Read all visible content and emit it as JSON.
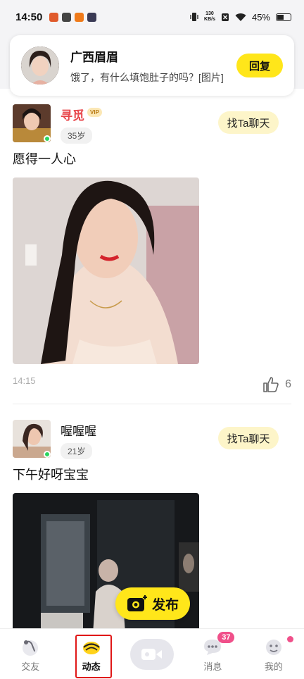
{
  "status_bar": {
    "time": "14:50",
    "net_speed_value": "130",
    "net_speed_unit": "KB/s",
    "battery": "45%"
  },
  "notification": {
    "name": "广西眉眉",
    "message": "饿了，有什么填饱肚子的吗？[图片]",
    "reply_label": "回复"
  },
  "posts": [
    {
      "user_name": "寻觅",
      "vip_label": "VIP",
      "age": "35岁",
      "chat_label": "找Ta聊天",
      "text": "愿得一人心",
      "time": "14:15",
      "likes": "6"
    },
    {
      "user_name": "喔喔喔",
      "age": "21岁",
      "chat_label": "找Ta聊天",
      "text": "下午好呀宝宝"
    }
  ],
  "fab": {
    "label": "发布"
  },
  "bottom_nav": {
    "items": [
      {
        "label": "交友",
        "icon": "friends-icon"
      },
      {
        "label": "动态",
        "icon": "moments-icon"
      },
      {
        "label": "",
        "icon": "video-icon"
      },
      {
        "label": "消息",
        "icon": "message-icon",
        "badge": "37"
      },
      {
        "label": "我的",
        "icon": "profile-icon"
      }
    ]
  },
  "colors": {
    "accent_yellow": "#ffe61a",
    "chat_button_bg": "#fdf5c9",
    "vip_name_red": "#e8474c",
    "badge_pink": "#f0508a",
    "selection_red": "#e01717"
  }
}
